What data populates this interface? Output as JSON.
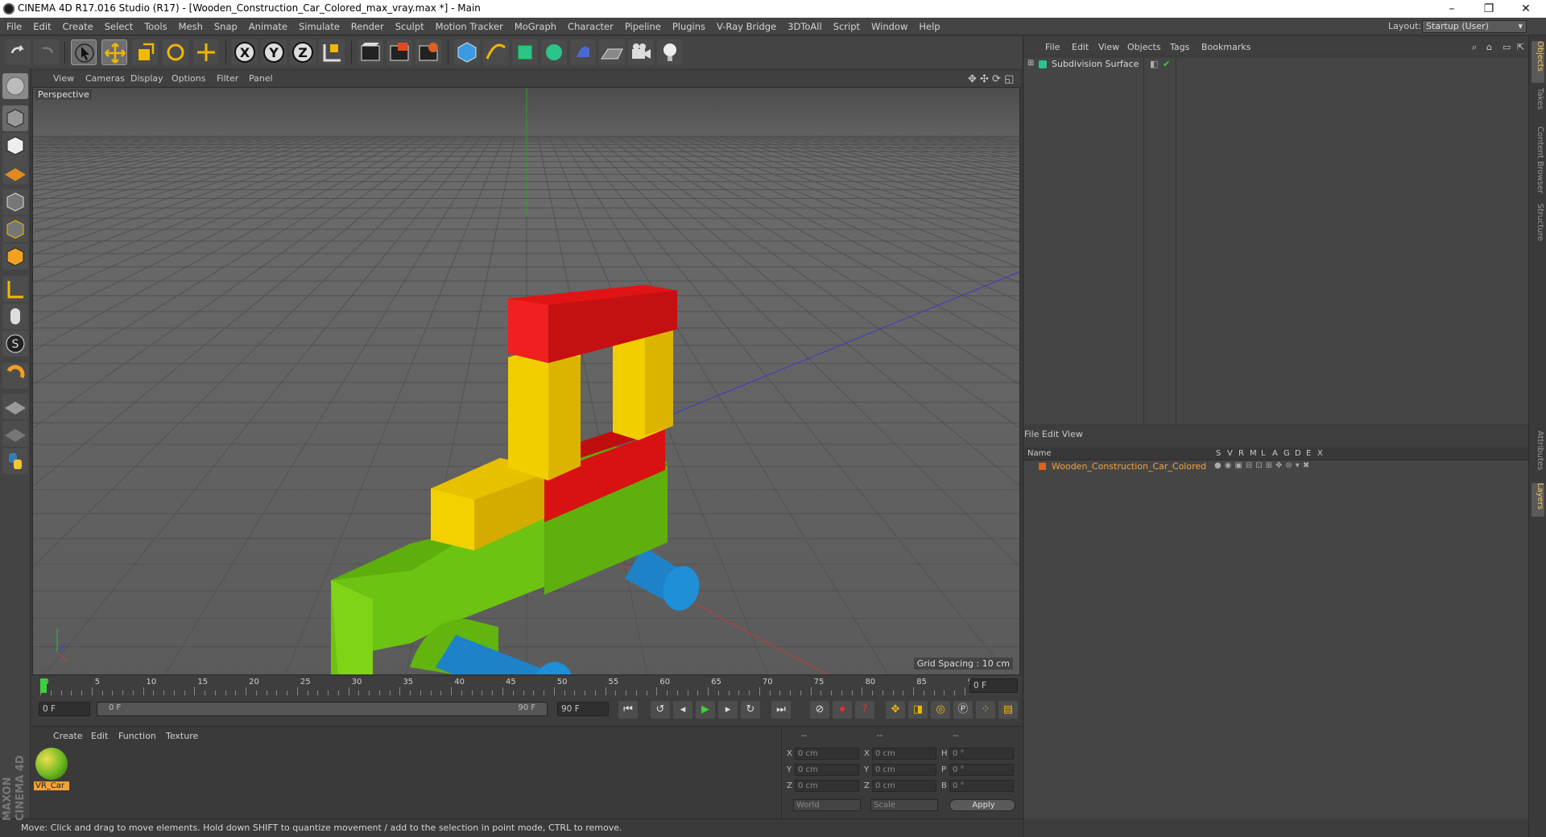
{
  "window": {
    "title": "CINEMA 4D R17.016 Studio (R17) - [Wooden_Construction_Car_Colored_max_vray.max *] - Main",
    "minimize": "–",
    "restore": "❐",
    "close": "✕"
  },
  "menu": [
    "File",
    "Edit",
    "Create",
    "Select",
    "Tools",
    "Mesh",
    "Snap",
    "Animate",
    "Simulate",
    "Render",
    "Sculpt",
    "Motion Tracker",
    "MoGraph",
    "Character",
    "Pipeline",
    "Plugins",
    "V-Ray Bridge",
    "3DToAll",
    "Script",
    "Window",
    "Help"
  ],
  "layout": {
    "label": "Layout:",
    "value": "Startup (User)"
  },
  "viewport": {
    "menu": [
      "View",
      "Cameras",
      "Display",
      "Options",
      "Filter",
      "Panel"
    ],
    "label": "Perspective",
    "grid_spacing": "Grid Spacing : 10 cm"
  },
  "timeline": {
    "ticks": [
      "0",
      "5",
      "10",
      "15",
      "20",
      "25",
      "30",
      "35",
      "40",
      "45",
      "50",
      "55",
      "60",
      "65",
      "70",
      "75",
      "80",
      "85",
      "90"
    ],
    "current_frame": "0 F"
  },
  "transport": {
    "start": "0 F",
    "range_start": "0 F",
    "range_end": "90 F",
    "end": "90 F"
  },
  "material_panel": {
    "menu": [
      "Create",
      "Edit",
      "Function",
      "Texture"
    ],
    "material_name": "VR_Car"
  },
  "coords": {
    "headers": [
      "--",
      "--",
      "--"
    ],
    "rows": [
      {
        "a": "X",
        "av": "0 cm",
        "b": "X",
        "bv": "0 cm",
        "c": "H",
        "cv": "0 °"
      },
      {
        "a": "Y",
        "av": "0 cm",
        "b": "Y",
        "bv": "0 cm",
        "c": "P",
        "cv": "0 °"
      },
      {
        "a": "Z",
        "av": "0 cm",
        "b": "Z",
        "bv": "0 cm",
        "c": "B",
        "cv": "0 °"
      }
    ],
    "world": "World",
    "scale": "Scale",
    "apply": "Apply"
  },
  "status": "Move: Click and drag to move elements. Hold down SHIFT to quantize movement / add to the selection in point mode, CTRL to remove.",
  "object_manager": {
    "menu": [
      "File",
      "Edit",
      "View",
      "Objects",
      "Tags",
      "Bookmarks"
    ],
    "object": "Subdivision Surface"
  },
  "layer_manager": {
    "menu": [
      "File",
      "Edit",
      "View"
    ],
    "columns": [
      "Name",
      "S",
      "V",
      "R",
      "M",
      "L",
      "A",
      "G",
      "D",
      "E",
      "X"
    ],
    "layer": "Wooden_Construction_Car_Colored"
  },
  "right_tabs": [
    "Objects",
    "Takes",
    "Content Browser",
    "Structure",
    "Attributes",
    "Layers"
  ],
  "maxon_logo": "MAXON CINEMA 4D",
  "colors": {
    "red": "#e01414",
    "yellow": "#f0c800",
    "green": "#6cc010",
    "blue": "#1e8ad2",
    "accent": "#f3a23a"
  }
}
